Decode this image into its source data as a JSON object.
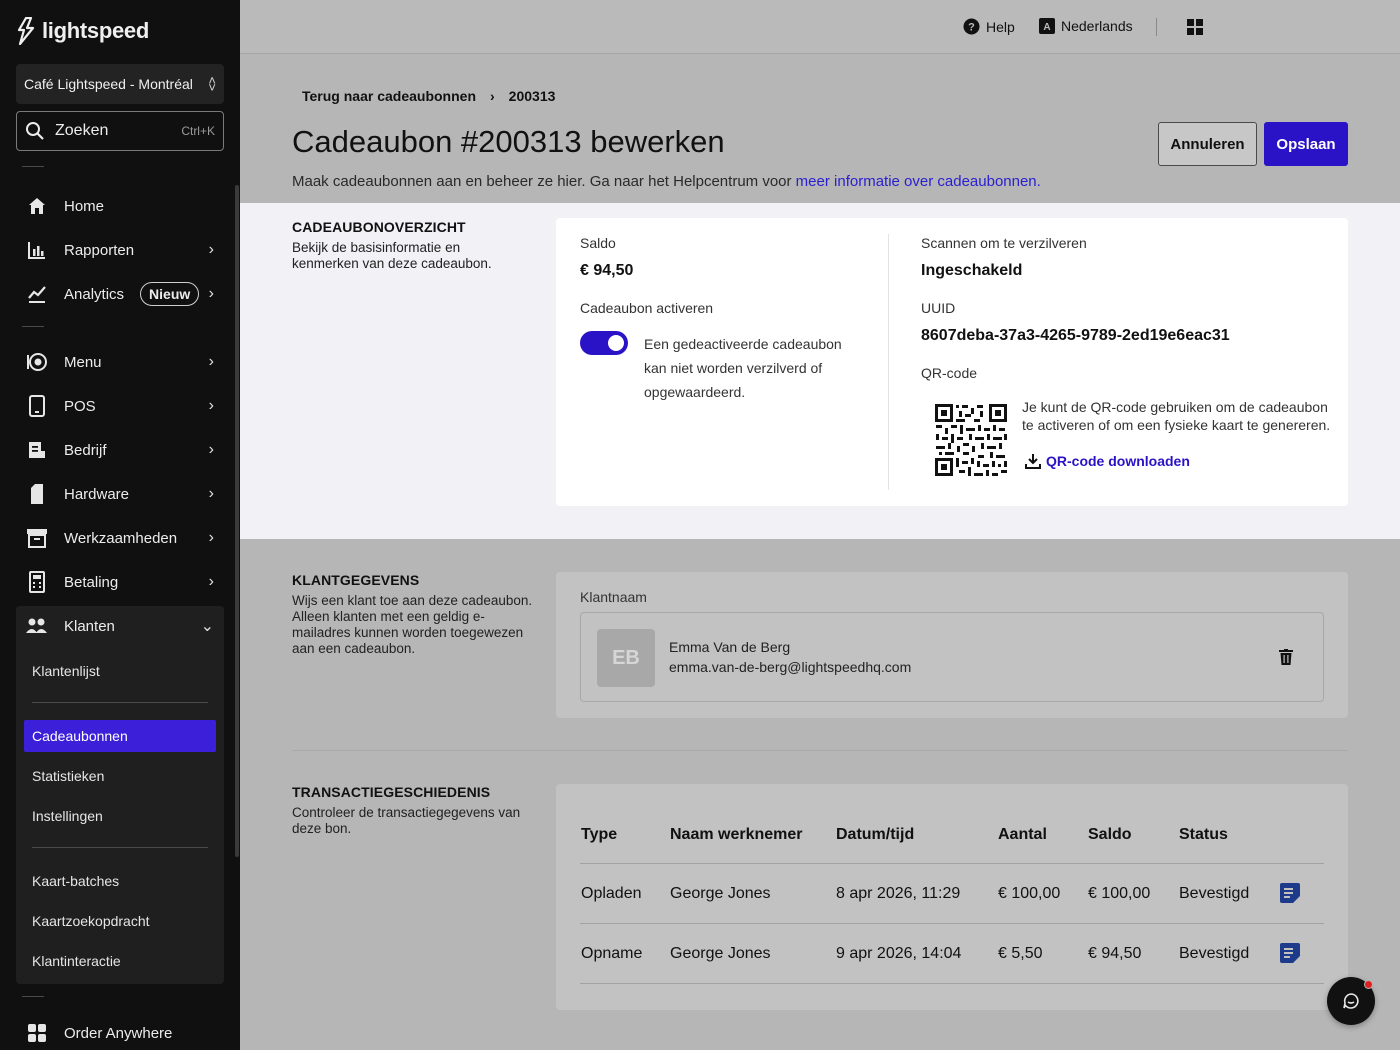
{
  "app": {
    "logo_text": "lightspeed"
  },
  "sidebar": {
    "store": "Café Lightspeed - Montréal",
    "search": {
      "label": "Zoeken",
      "shortcut": "Ctrl+K"
    },
    "nav": [
      {
        "label": "Home"
      },
      {
        "label": "Rapporten"
      },
      {
        "label": "Analytics",
        "badge": "Nieuw"
      },
      {
        "label": "Menu"
      },
      {
        "label": "POS"
      },
      {
        "label": "Bedrijf"
      },
      {
        "label": "Hardware"
      },
      {
        "label": "Werkzaamheden"
      },
      {
        "label": "Betaling"
      },
      {
        "label": "Klanten"
      }
    ],
    "sub": [
      "Klantenlijst",
      "Cadeaubonnen",
      "Statistieken",
      "Instellingen",
      "Kaart-batches",
      "Kaartzoekopdracht",
      "Klantinteractie"
    ],
    "active_sub": "Cadeaubonnen",
    "order_anywhere": "Order Anywhere"
  },
  "topbar": {
    "help": "Help",
    "language": "Nederlands"
  },
  "breadcrumb": {
    "back": "Terug naar cadeaubonnen",
    "current": "200313"
  },
  "page": {
    "title": "Cadeaubon #200313 bewerken",
    "subtitle": "Maak cadeaubonnen aan en beheer ze hier. Ga naar het Helpcentrum voor ",
    "subtitle_link": "meer informatie over cadeaubonnen.",
    "cancel": "Annuleren",
    "save": "Opslaan"
  },
  "overview": {
    "title": "CADEAUBONOVERZICHT",
    "desc": "Bekijk de basisinformatie en kenmerken van deze cadeaubon.",
    "saldo_label": "Saldo",
    "saldo_value": "€ 94,50",
    "activate_label": "Cadeaubon activeren",
    "activate_on": true,
    "activate_desc": "Een gedeactiveerde cadeaubon kan niet worden verzilverd of opgewaardeerd.",
    "scan_label": "Scannen om te verzilveren",
    "scan_value": "Ingeschakeld",
    "uuid_label": "UUID",
    "uuid_value": "8607deba-37a3-4265-9789-2ed19e6eac31",
    "qr_label": "QR-code",
    "qr_text": "Je kunt de QR-code gebruiken om de cadeaubon te activeren of om een fysieke kaart te genereren.",
    "qr_download": "QR-code downloaden"
  },
  "customer": {
    "title": "KLANTGEGEVENS",
    "desc": "Wijs een klant toe aan deze cadeaubon. Alleen klanten met een geldig e-mailadres kunnen worden toegewezen aan een cadeaubon.",
    "label": "Klantnaam",
    "initials": "EB",
    "name": "Emma Van de Berg",
    "email": "emma.van-de-berg@lightspeedhq.com"
  },
  "transactions": {
    "title": "TRANSACTIEGESCHIEDENIS",
    "desc": "Controleer de transactiegegevens van deze bon.",
    "headers": [
      "Type",
      "Naam werknemer",
      "Datum/tijd",
      "Aantal",
      "Saldo",
      "Status"
    ],
    "rows": [
      [
        "Opladen",
        "George Jones",
        "8 apr 2026, 11:29",
        "€ 100,00",
        "€ 100,00",
        "Bevestigd"
      ],
      [
        "Opname",
        "George Jones",
        "9 apr 2026, 14:04",
        "€ 5,50",
        "€ 94,50",
        "Bevestigd"
      ]
    ]
  },
  "colors": {
    "accent": "#2a12c7",
    "sidebar_bg": "#101010"
  }
}
